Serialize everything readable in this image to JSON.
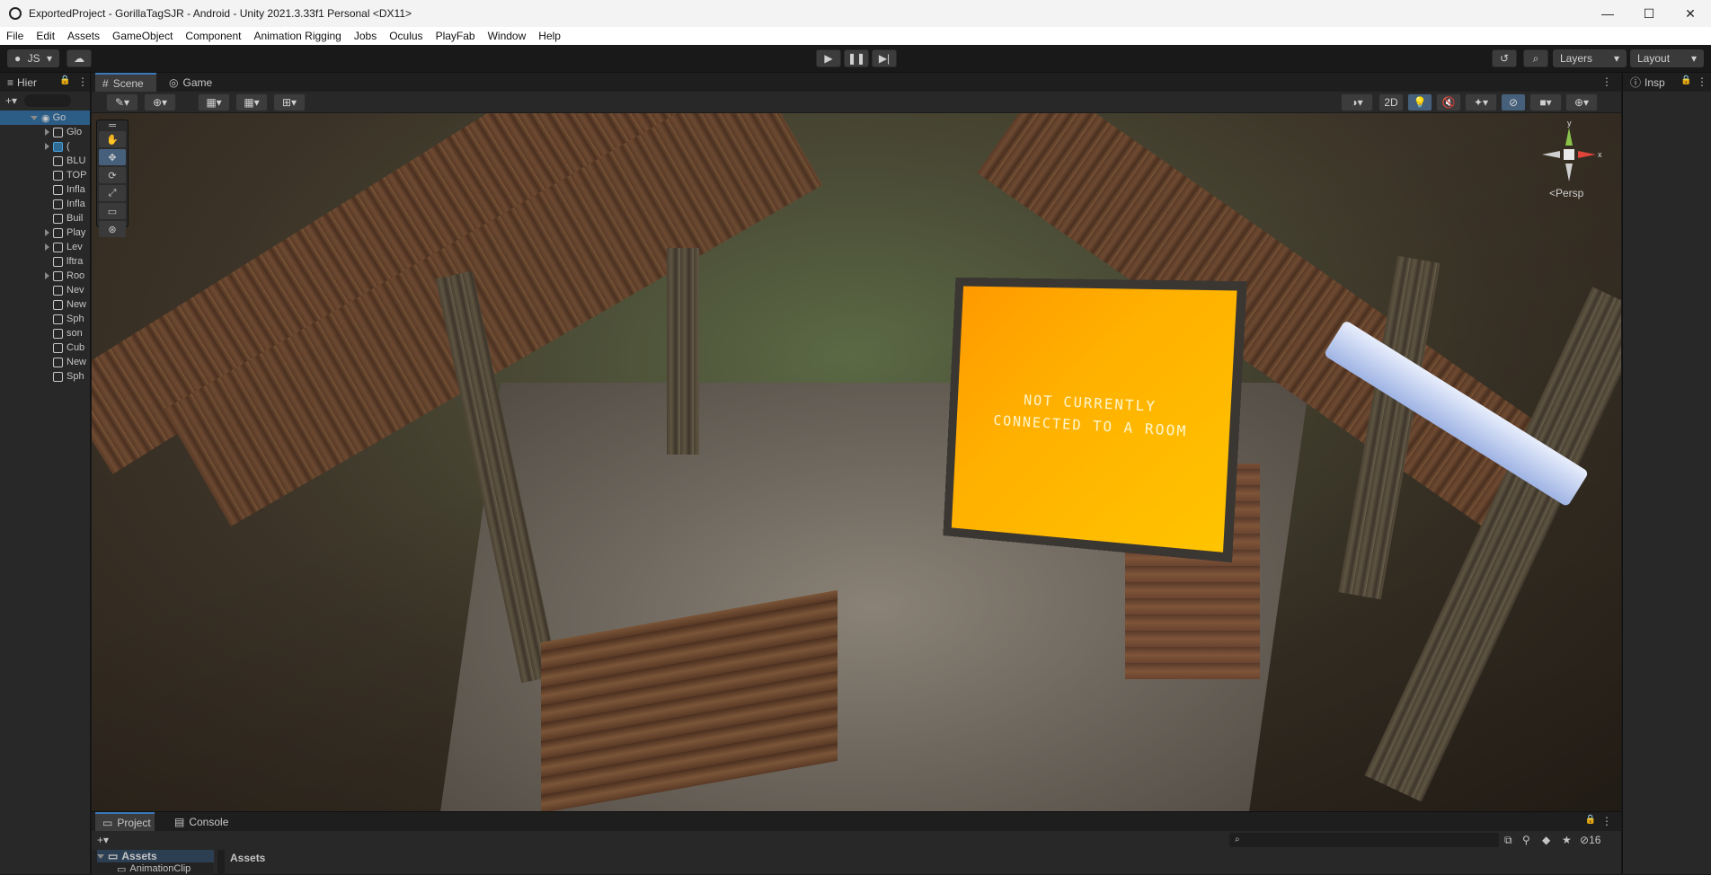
{
  "window": {
    "title": "ExportedProject - GorillaTagSJR - Android - Unity 2021.3.33f1 Personal <DX11>",
    "minimize": "—",
    "maximize": "☐",
    "close": "✕"
  },
  "menu": [
    "File",
    "Edit",
    "Assets",
    "GameObject",
    "Component",
    "Animation Rigging",
    "Jobs",
    "Oculus",
    "PlayFab",
    "Window",
    "Help"
  ],
  "toolbar": {
    "account": "JS",
    "layers": "Layers",
    "layout": "Layout"
  },
  "hierarchy": {
    "tab": "Hier",
    "scene_root": "Go",
    "items": [
      "Glo",
      "(",
      "BLU",
      "TOP",
      "Infla",
      "Infla",
      "Buil",
      "Play",
      "Lev",
      "lftra",
      "Roo",
      "Nev",
      "New",
      "Sph",
      "son",
      "Cub",
      "New",
      "Sph"
    ]
  },
  "scene": {
    "tabs": [
      "Scene",
      "Game"
    ],
    "toggle_2d": "2D",
    "persp_label": "<Persp",
    "sign_line1": "NOT CURRENTLY",
    "sign_line2": "CONNECTED TO A ROOM"
  },
  "inspector": {
    "tab": "Insp"
  },
  "project": {
    "tabs": [
      "Project",
      "Console"
    ],
    "tree_root": "Assets",
    "tree_child": "AnimationClip",
    "breadcrumb": "Assets",
    "hidden_count": "16"
  },
  "colors": {
    "accent": "#3a79bb",
    "sign": "#ffb000"
  }
}
